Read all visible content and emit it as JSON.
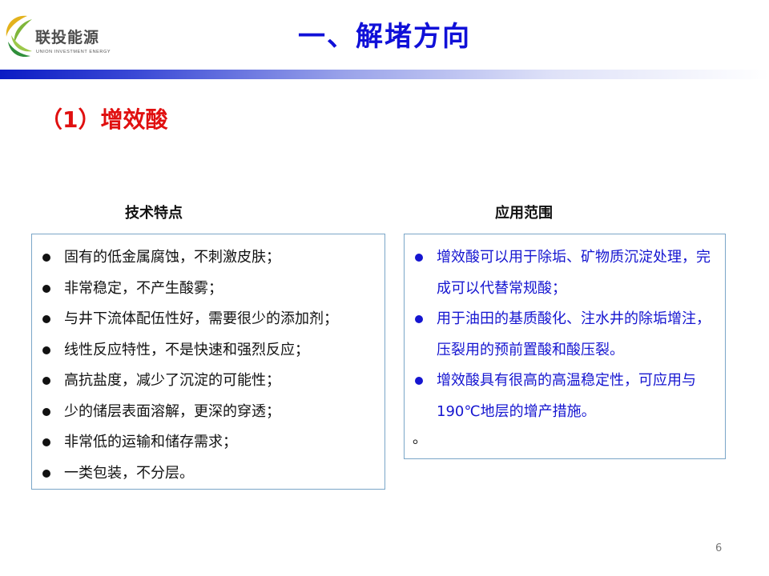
{
  "logo": {
    "name": "联投能源",
    "subtitle": "UNION INVESTMENT ENERGY"
  },
  "title": "一、解堵方向",
  "section_title": "（1）增效酸",
  "left_column": {
    "heading": "技术特点",
    "items": [
      "固有的低金属腐蚀，不刺激皮肤；",
      "非常稳定，不产生酸雾；",
      "与井下流体配伍性好，需要很少的添加剂；",
      "线性反应特性，不是快速和强烈反应；",
      "高抗盐度，减少了沉淀的可能性；",
      "少的储层表面溶解，更深的穿透；",
      "非常低的运输和储存需求；",
      "一类包装，不分层。"
    ]
  },
  "right_column": {
    "heading": "应用范围",
    "items": [
      "增效酸可以用于除垢、矿物质沉淀处理，完成可以代替常规酸；",
      "用于油田的基质酸化、注水井的除垢增注，压裂用的预前置酸和酸压裂。",
      "增效酸具有很高的高温稳定性，可应用与190℃地层的增产措施。"
    ],
    "tail": "。"
  },
  "page_number": "6",
  "colors": {
    "title": "#1010d8",
    "section_title": "#e01010",
    "right_text": "#1515d0",
    "box_border": "#7aa6c8"
  }
}
